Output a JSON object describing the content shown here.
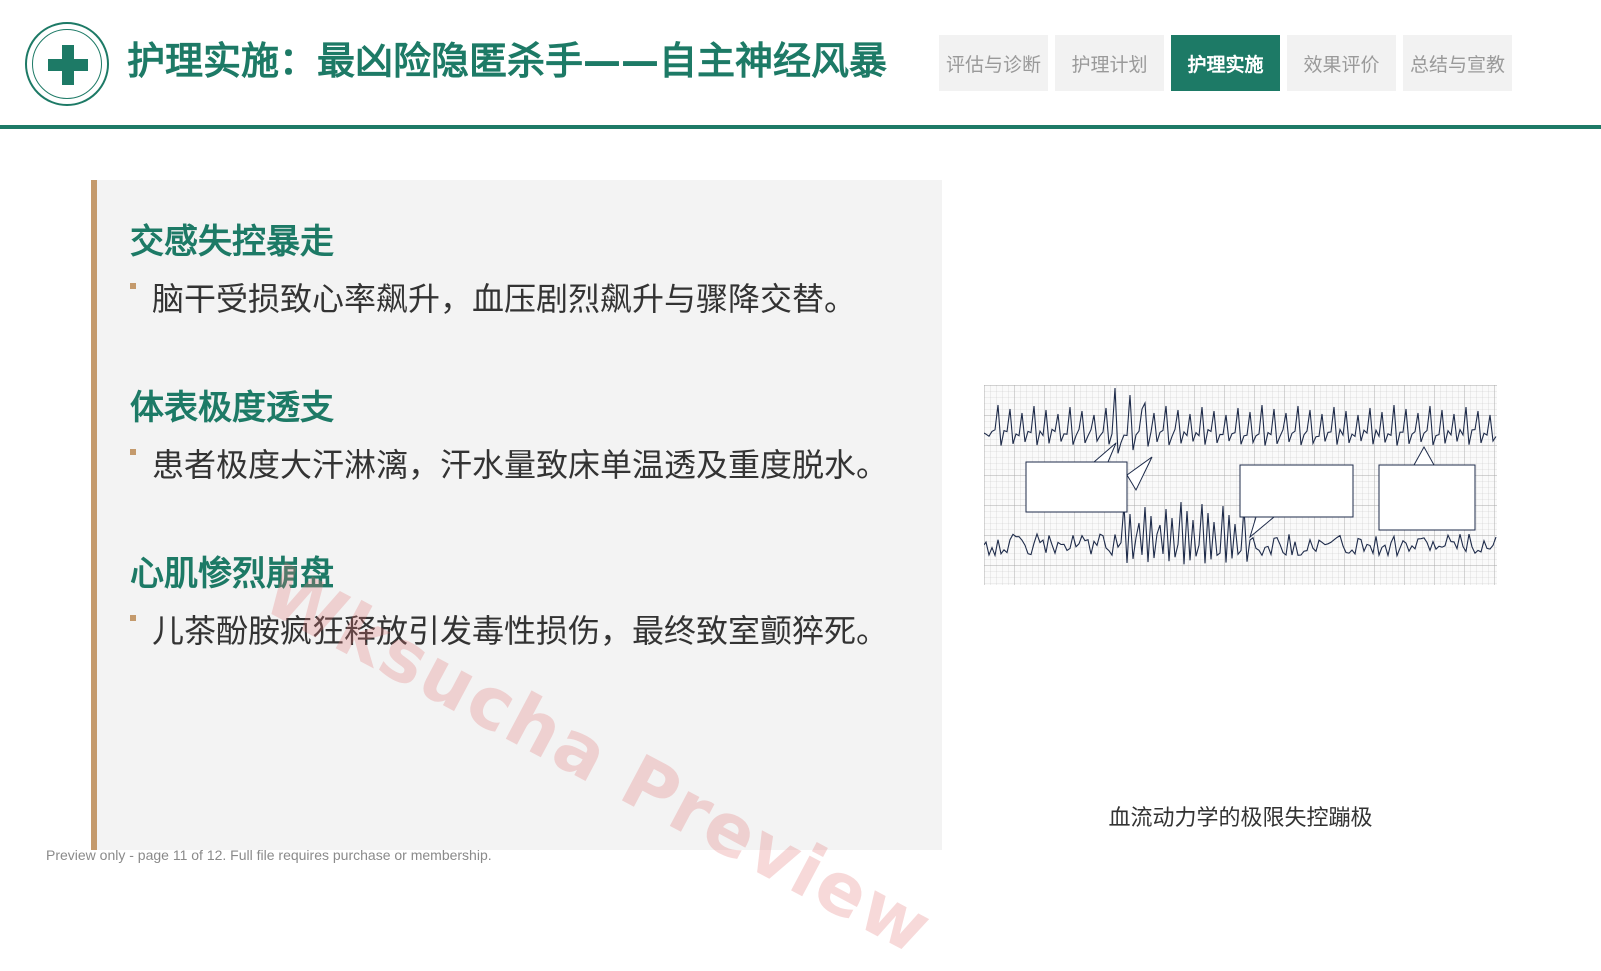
{
  "header": {
    "title": "护理实施：最凶险隐匿杀手——自主神经风暴",
    "tabs": [
      {
        "label": "评估与诊断",
        "active": false
      },
      {
        "label": "护理计划",
        "active": false
      },
      {
        "label": "护理实施",
        "active": true
      },
      {
        "label": "效果评价",
        "active": false
      },
      {
        "label": "总结与宣教",
        "active": false
      }
    ]
  },
  "sections": [
    {
      "heading": "交感失控暴走",
      "text": "脑干受损致心率飙升，血压剧烈飙升与骤降交替。"
    },
    {
      "heading": "体表极度透支",
      "text": "患者极度大汗淋漓，汗水量致床单温透及重度脱水。"
    },
    {
      "heading": "心肌惨烈崩盘",
      "text": "儿茶酚胺疯狂释放引发毒性损伤，最终致室颤猝死。"
    }
  ],
  "figure": {
    "caption": "血流动力学的极限失控蹦极",
    "icon": "ecg-waveform-illustration"
  },
  "watermark": "Wksucha Preview",
  "footer": "Preview only - page 11 of 12. Full file requires purchase or membership.",
  "colors": {
    "primary": "#1d7a66",
    "accent": "#c49a6c",
    "panel_bg": "#f3f3f3",
    "tab_bg": "#f2f2f2"
  }
}
